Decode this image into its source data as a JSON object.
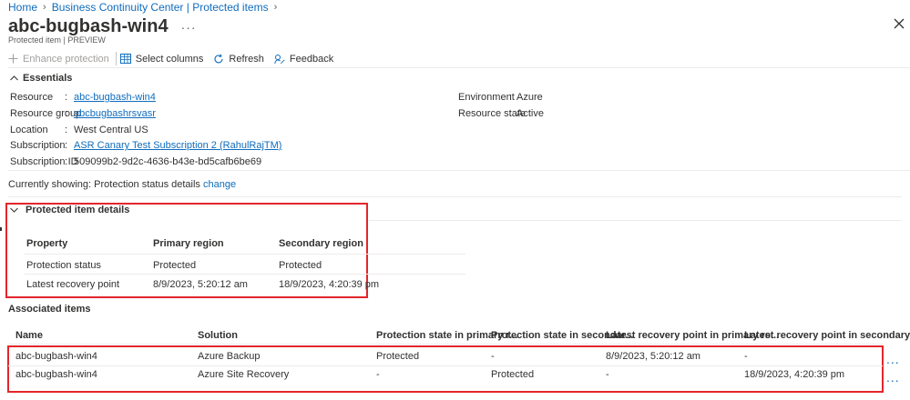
{
  "breadcrumb": [
    {
      "label": "Home"
    },
    {
      "label": "Business Continuity Center | Protected items"
    }
  ],
  "header": {
    "title": "abc-bugbash-win4",
    "more": "···",
    "subtitle": "Protected item | PREVIEW",
    "close_icon": "close-icon"
  },
  "toolbar": {
    "enhance_protection": "Enhance protection",
    "select_columns": "Select columns",
    "refresh": "Refresh",
    "feedback": "Feedback"
  },
  "essentials": {
    "title": "Essentials",
    "left": [
      {
        "label": "Resource",
        "value": "abc-bugbash-win4",
        "link": true
      },
      {
        "label": "Resource group",
        "value": "abcbugbashrsvasr",
        "link": true
      },
      {
        "label": "Location",
        "value": "West Central US",
        "link": false
      },
      {
        "label": "Subscription",
        "value": "ASR Canary Test Subscription 2 (RahulRajTM)",
        "link": true
      },
      {
        "label": "Subscription ID",
        "value": "509099b2-9d2c-4636-b43e-bd5cafb6be69",
        "link": false
      }
    ],
    "right": [
      {
        "label": "Environment",
        "value": "Azure"
      },
      {
        "label": "Resource state",
        "value": "Active"
      }
    ]
  },
  "showing": {
    "text": "Currently showing: Protection status details",
    "change": "change"
  },
  "protected_item_details": {
    "title": "Protected item details",
    "columns": [
      "Property",
      "Primary region",
      "Secondary region"
    ],
    "rows": [
      [
        "Protection status",
        "Protected",
        "Protected"
      ],
      [
        "Latest recovery point",
        "8/9/2023, 5:20:12 am",
        "18/9/2023, 4:20:39 pm"
      ]
    ]
  },
  "associated_items": {
    "title": "Associated items",
    "columns": [
      "Name",
      "Solution",
      "Protection state in primary r...",
      "Protection state in secondar...",
      "Latest recovery point in primary re...",
      "Latest recovery point in secondary ..."
    ],
    "rows": [
      [
        "abc-bugbash-win4",
        "Azure Backup",
        "Protected",
        "-",
        "8/9/2023, 5:20:12 am",
        "-"
      ],
      [
        "abc-bugbash-win4",
        "Azure Site Recovery",
        "-",
        "Protected",
        "-",
        "18/9/2023, 4:20:39 pm"
      ]
    ],
    "row_more": "..."
  },
  "colors": {
    "link": "#0f6cbd",
    "highlight": "#e3262b",
    "text": "#323130"
  }
}
